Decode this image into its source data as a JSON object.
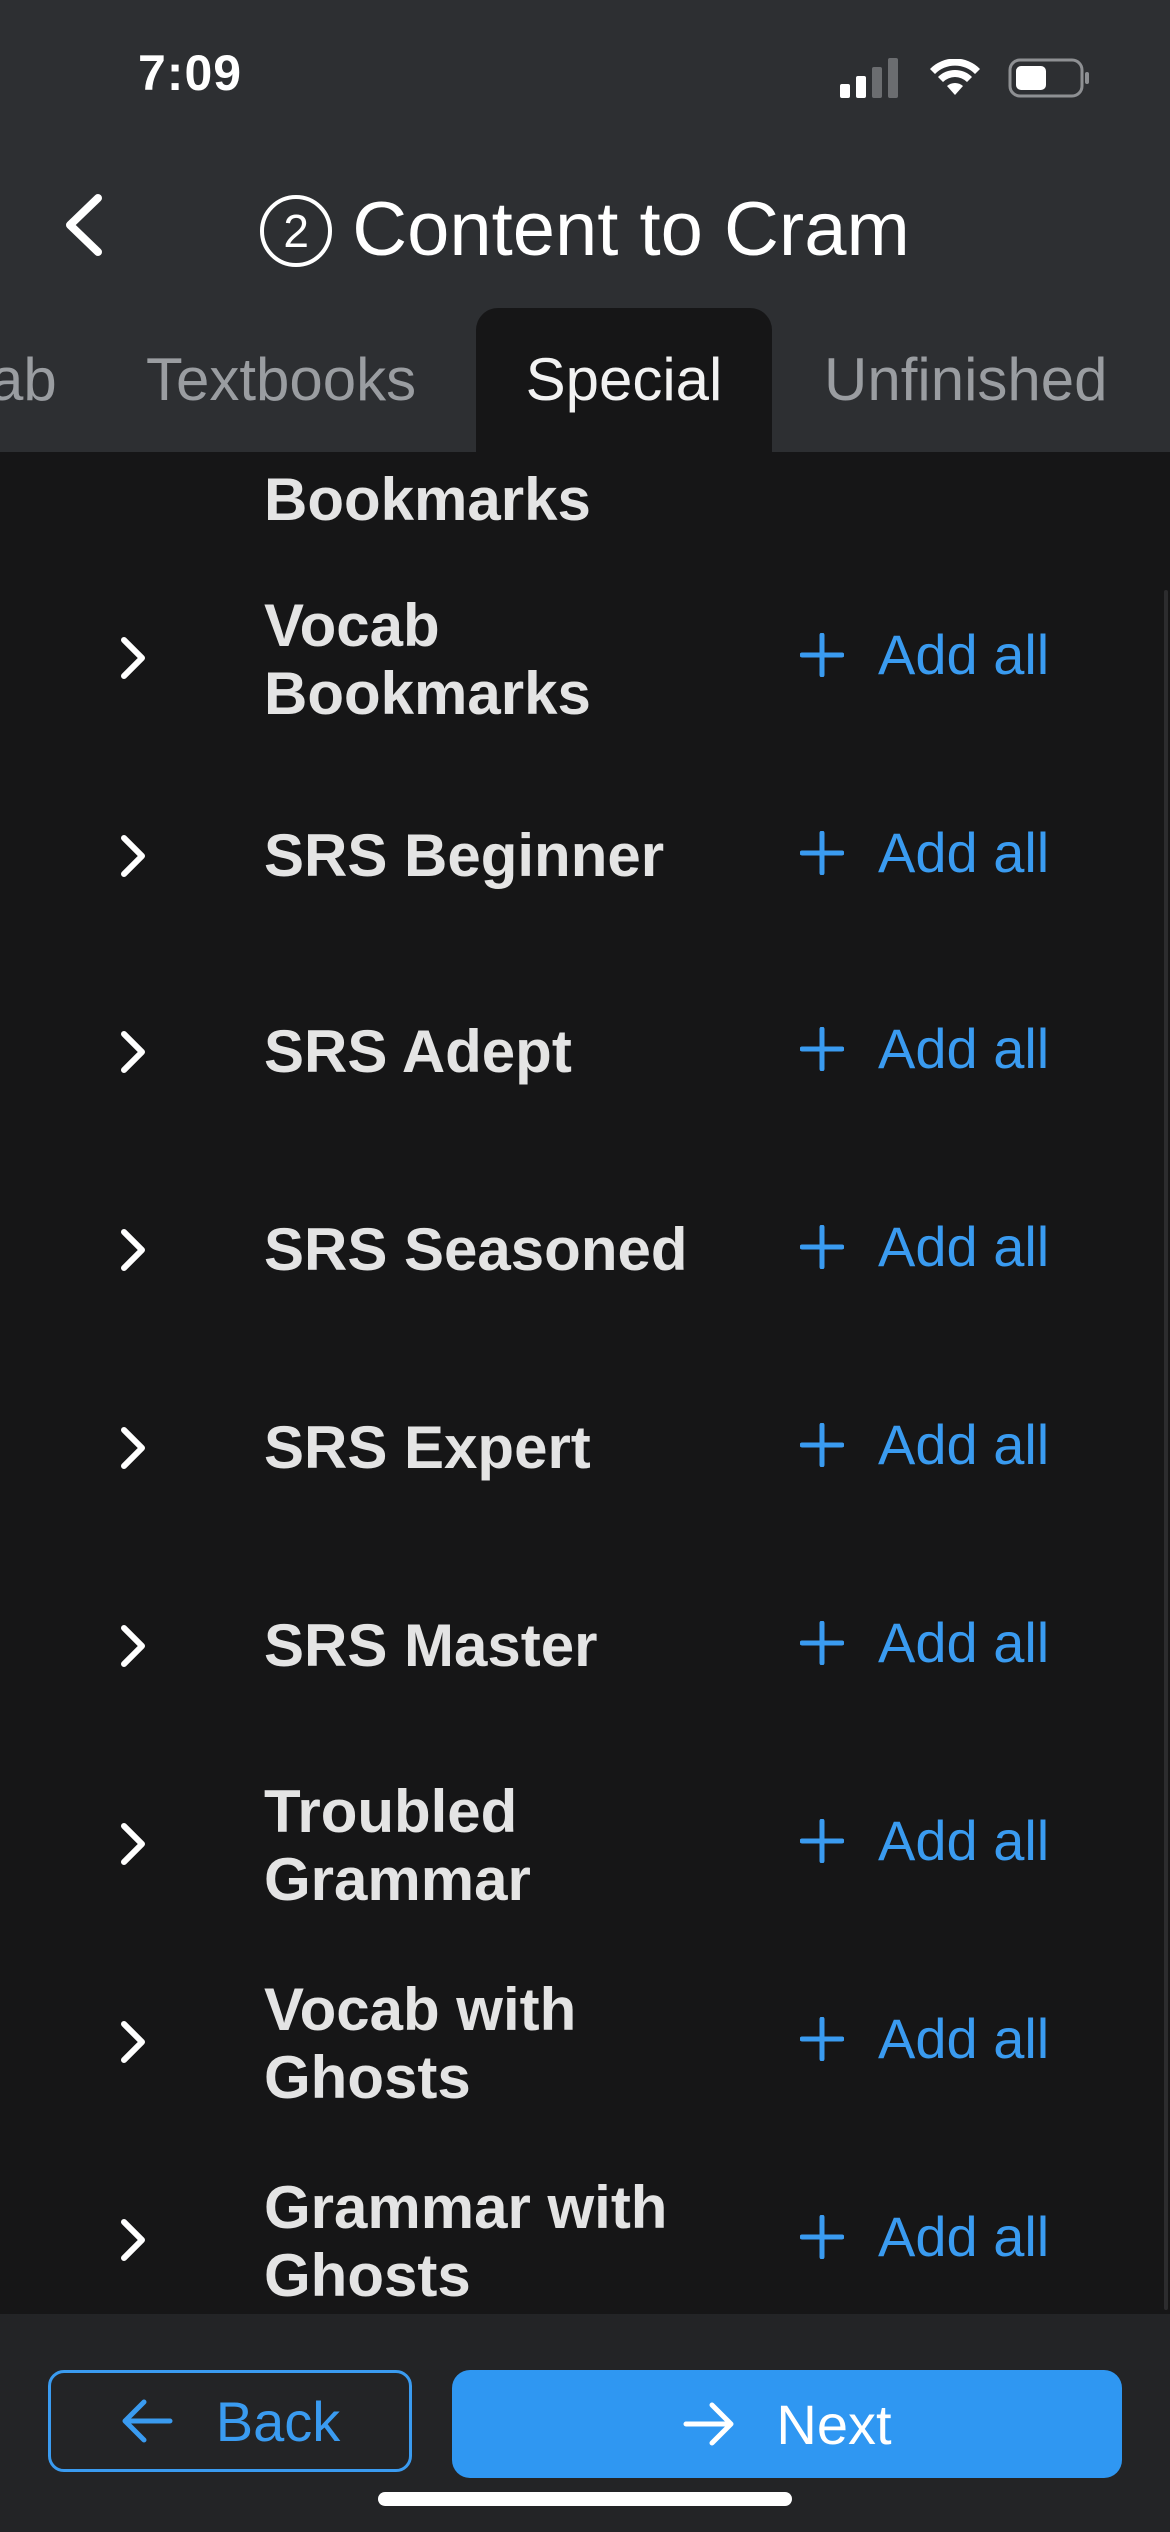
{
  "status_bar": {
    "time": "7:09",
    "icons": [
      "cellular-signal-icon",
      "wifi-icon",
      "battery-icon"
    ]
  },
  "nav": {
    "back_icon": "chevron-left-icon",
    "step_number": "2",
    "title": "Content to Cram"
  },
  "tabs": [
    {
      "label": "ab",
      "active": false
    },
    {
      "label": "Textbooks",
      "active": false
    },
    {
      "label": "Special",
      "active": true
    },
    {
      "label": "Unfinished",
      "active": false
    }
  ],
  "list": {
    "add_label": "Add all",
    "items": [
      {
        "label": "Bookmarks"
      },
      {
        "label": "Vocab Bookmarks"
      },
      {
        "label": "SRS Beginner"
      },
      {
        "label": "SRS Adept"
      },
      {
        "label": "SRS Seasoned"
      },
      {
        "label": "SRS Expert"
      },
      {
        "label": "SRS Master"
      },
      {
        "label": "Troubled Grammar"
      },
      {
        "label": "Vocab with Ghosts"
      },
      {
        "label": "Grammar with Ghosts"
      }
    ]
  },
  "footer": {
    "back_label": "Back",
    "next_label": "Next"
  },
  "colors": {
    "accent": "#3a9bf0",
    "primary_button": "#2f97f2",
    "header_bg": "#2d2f32",
    "list_bg": "#161617"
  }
}
